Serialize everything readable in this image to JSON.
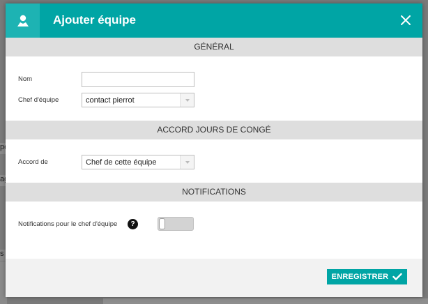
{
  "backdrop": {
    "fragments": [
      "pe",
      "ag",
      "s a"
    ]
  },
  "modal": {
    "title": "Ajouter équipe",
    "header_icon": "user-icon",
    "close_icon": "close-icon"
  },
  "sections": {
    "general": {
      "title": "GÉNÉRAL",
      "name_label": "Nom",
      "name_value": "",
      "chef_label": "Chef d'équipe",
      "chef_value": "contact pierrot"
    },
    "leave": {
      "title": "ACCORD JOURS DE CONGÉ",
      "accord_label": "Accord de",
      "accord_value": "Chef de cette équipe"
    },
    "notifications": {
      "title": "NOTIFICATIONS",
      "chef_notif_label": "Notifications pour le chef d'équipe",
      "help_icon": "help-icon",
      "toggle_on": false
    }
  },
  "footer": {
    "save_label": "ENREGISTRER",
    "save_icon": "checkmark-icon"
  },
  "colors": {
    "accent": "#00a5a5",
    "section_bg": "#dedede",
    "footer_bg": "#f2f2f2"
  }
}
